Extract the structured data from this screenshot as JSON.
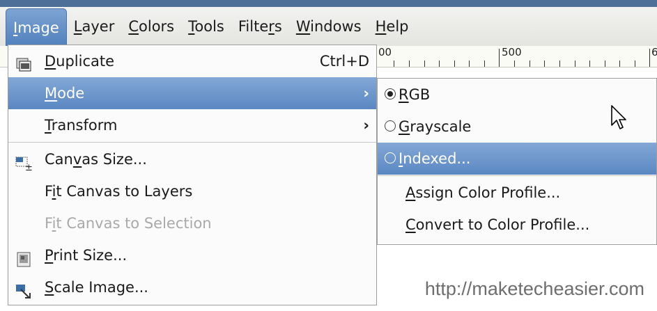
{
  "menubar": {
    "items": [
      {
        "pre": "",
        "u": "I",
        "post": "mage"
      },
      {
        "pre": "",
        "u": "L",
        "post": "ayer"
      },
      {
        "pre": "",
        "u": "C",
        "post": "olors"
      },
      {
        "pre": "",
        "u": "T",
        "post": "ools"
      },
      {
        "pre": "Filte",
        "u": "r",
        "post": "s"
      },
      {
        "pre": "",
        "u": "W",
        "post": "indows"
      },
      {
        "pre": "",
        "u": "H",
        "post": "elp"
      }
    ]
  },
  "ruler": {
    "labels": [
      "00",
      "500",
      "6"
    ]
  },
  "image_menu": {
    "duplicate": {
      "pre": "",
      "u": "D",
      "post": "uplicate",
      "shortcut": "Ctrl+D",
      "icon": "duplicate-icon"
    },
    "mode": {
      "pre": "",
      "u": "M",
      "post": "ode",
      "arrow": "›"
    },
    "transform": {
      "pre": "",
      "u": "T",
      "post": "ransform",
      "arrow": "›"
    },
    "canvas_size": {
      "pre": "Can",
      "u": "v",
      "post": "as Size...",
      "icon": "canvas-size-icon"
    },
    "fit_layers": {
      "pre": "F",
      "u": "i",
      "post": "t Canvas to Layers"
    },
    "fit_selection": {
      "pre": "F",
      "u": "i",
      "post": "t Canvas to Selection"
    },
    "print_size": {
      "pre": "",
      "u": "P",
      "post": "rint Size...",
      "icon": "print-size-icon"
    },
    "scale_image": {
      "pre": "",
      "u": "S",
      "post": "cale Image...",
      "icon": "scale-image-icon"
    }
  },
  "mode_submenu": {
    "rgb": {
      "pre": "",
      "u": "R",
      "post": "GB",
      "checked": true
    },
    "grayscale": {
      "pre": "",
      "u": "G",
      "post": "rayscale",
      "checked": false
    },
    "indexed": {
      "pre": "",
      "u": "I",
      "post": "ndexed...",
      "checked": false
    },
    "assign_profile": {
      "pre": "",
      "u": "A",
      "post": "ssign Color Profile..."
    },
    "convert_profile": {
      "pre": "",
      "u": "C",
      "post": "onvert to Color Profile..."
    }
  },
  "watermark": "http://maketecheasier.com",
  "colors": {
    "highlight": "#5a87c2",
    "menubar": "#e9e9e6",
    "accent_strip": "#4d6f98"
  }
}
